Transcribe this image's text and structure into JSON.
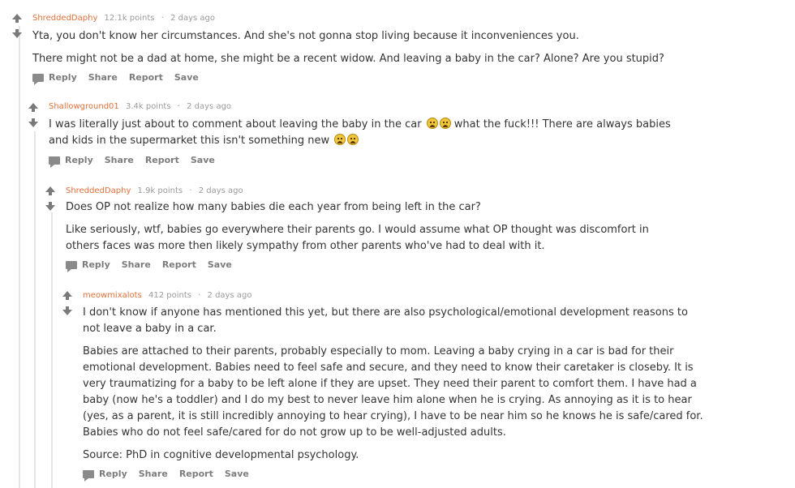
{
  "comments": [
    {
      "author": "ShreddedDaphy",
      "points": "12.1k points",
      "sep": "·",
      "time": "2 days ago",
      "paragraphs": [
        "Yta, you don't know her circumstances. And she's not gonna stop living because it inconveniences you.",
        "There might not be a dad at home, she might be a recent widow. And leaving a baby in the car? Alone? Are you stupid?"
      ]
    },
    {
      "author": "Shallowground01",
      "points": "3.4k points",
      "sep": "·",
      "time": "2 days ago",
      "text_a": "I was literally just about to comment about leaving the baby in the car ",
      "text_b": " what the fuck!!! There are always babies and kids in the supermarket this isn't something new "
    },
    {
      "author": "ShreddedDaphy",
      "points": "1.9k points",
      "sep": "·",
      "time": "2 days ago",
      "paragraphs": [
        "Does OP not realize how many babies die each year from being left in the car?",
        "Like seriously, wtf, babies go everywhere their parents go. I would assume what OP thought was discomfort in others faces was more then likely sympathy from other parents who've had to deal with it."
      ]
    },
    {
      "author": "meowmixalots",
      "points": "412 points",
      "sep": "·",
      "time": "2 days ago",
      "paragraphs": [
        "I don't know if anyone has mentioned this yet, but there are also psychological/emotional development reasons to not leave a baby in a car.",
        "Babies are attached to their parents, probably especially to mom. Leaving a baby crying in a car is bad for their emotional development. Babies need to feel safe and secure, and they need to know their caretaker is closeby. It is very traumatizing for a baby to be left alone if they are upset. They need their parent to comfort them. I have had a baby (now he's a toddler) and I do my best to never leave him alone when he is crying. As annoying as it is to hear (yes, as a parent, it is still incredibly annoying to hear crying), I have to be near him so he knows he is safe/cared for. Babies who do not feel safe/cared for do not grow up to be well-adjusted adults.",
        "Source: PhD in cognitive developmental psychology."
      ]
    }
  ],
  "actions": {
    "reply": "Reply",
    "share": "Share",
    "report": "Report",
    "save": "Save"
  },
  "icons": {
    "upvote": "upvote-arrow-icon",
    "downvote": "downvote-arrow-icon",
    "reply": "comment-bubble-icon",
    "emoji": "grimacing-face-emoji"
  },
  "colors": {
    "author": "#e0703a",
    "meta": "#9a9a9a",
    "text": "#333333",
    "thread_line": "#e6e6e6"
  }
}
